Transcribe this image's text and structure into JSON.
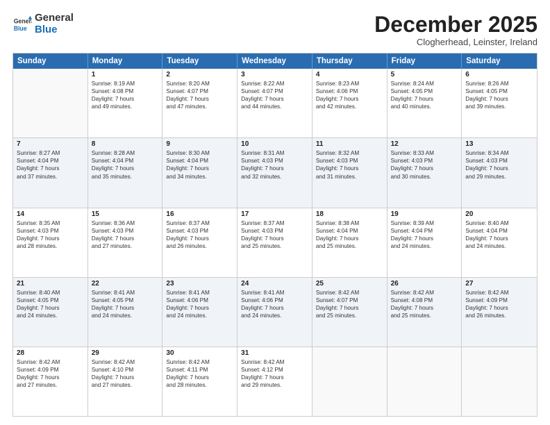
{
  "logo": {
    "general": "General",
    "blue": "Blue"
  },
  "header": {
    "month": "December 2025",
    "location": "Clogherhead, Leinster, Ireland"
  },
  "weekdays": [
    "Sunday",
    "Monday",
    "Tuesday",
    "Wednesday",
    "Thursday",
    "Friday",
    "Saturday"
  ],
  "weeks": [
    [
      {
        "day": "",
        "lines": []
      },
      {
        "day": "1",
        "lines": [
          "Sunrise: 8:19 AM",
          "Sunset: 4:08 PM",
          "Daylight: 7 hours",
          "and 49 minutes."
        ]
      },
      {
        "day": "2",
        "lines": [
          "Sunrise: 8:20 AM",
          "Sunset: 4:07 PM",
          "Daylight: 7 hours",
          "and 47 minutes."
        ]
      },
      {
        "day": "3",
        "lines": [
          "Sunrise: 8:22 AM",
          "Sunset: 4:07 PM",
          "Daylight: 7 hours",
          "and 44 minutes."
        ]
      },
      {
        "day": "4",
        "lines": [
          "Sunrise: 8:23 AM",
          "Sunset: 4:06 PM",
          "Daylight: 7 hours",
          "and 42 minutes."
        ]
      },
      {
        "day": "5",
        "lines": [
          "Sunrise: 8:24 AM",
          "Sunset: 4:05 PM",
          "Daylight: 7 hours",
          "and 40 minutes."
        ]
      },
      {
        "day": "6",
        "lines": [
          "Sunrise: 8:26 AM",
          "Sunset: 4:05 PM",
          "Daylight: 7 hours",
          "and 39 minutes."
        ]
      }
    ],
    [
      {
        "day": "7",
        "lines": [
          "Sunrise: 8:27 AM",
          "Sunset: 4:04 PM",
          "Daylight: 7 hours",
          "and 37 minutes."
        ]
      },
      {
        "day": "8",
        "lines": [
          "Sunrise: 8:28 AM",
          "Sunset: 4:04 PM",
          "Daylight: 7 hours",
          "and 35 minutes."
        ]
      },
      {
        "day": "9",
        "lines": [
          "Sunrise: 8:30 AM",
          "Sunset: 4:04 PM",
          "Daylight: 7 hours",
          "and 34 minutes."
        ]
      },
      {
        "day": "10",
        "lines": [
          "Sunrise: 8:31 AM",
          "Sunset: 4:03 PM",
          "Daylight: 7 hours",
          "and 32 minutes."
        ]
      },
      {
        "day": "11",
        "lines": [
          "Sunrise: 8:32 AM",
          "Sunset: 4:03 PM",
          "Daylight: 7 hours",
          "and 31 minutes."
        ]
      },
      {
        "day": "12",
        "lines": [
          "Sunrise: 8:33 AM",
          "Sunset: 4:03 PM",
          "Daylight: 7 hours",
          "and 30 minutes."
        ]
      },
      {
        "day": "13",
        "lines": [
          "Sunrise: 8:34 AM",
          "Sunset: 4:03 PM",
          "Daylight: 7 hours",
          "and 29 minutes."
        ]
      }
    ],
    [
      {
        "day": "14",
        "lines": [
          "Sunrise: 8:35 AM",
          "Sunset: 4:03 PM",
          "Daylight: 7 hours",
          "and 28 minutes."
        ]
      },
      {
        "day": "15",
        "lines": [
          "Sunrise: 8:36 AM",
          "Sunset: 4:03 PM",
          "Daylight: 7 hours",
          "and 27 minutes."
        ]
      },
      {
        "day": "16",
        "lines": [
          "Sunrise: 8:37 AM",
          "Sunset: 4:03 PM",
          "Daylight: 7 hours",
          "and 26 minutes."
        ]
      },
      {
        "day": "17",
        "lines": [
          "Sunrise: 8:37 AM",
          "Sunset: 4:03 PM",
          "Daylight: 7 hours",
          "and 25 minutes."
        ]
      },
      {
        "day": "18",
        "lines": [
          "Sunrise: 8:38 AM",
          "Sunset: 4:04 PM",
          "Daylight: 7 hours",
          "and 25 minutes."
        ]
      },
      {
        "day": "19",
        "lines": [
          "Sunrise: 8:39 AM",
          "Sunset: 4:04 PM",
          "Daylight: 7 hours",
          "and 24 minutes."
        ]
      },
      {
        "day": "20",
        "lines": [
          "Sunrise: 8:40 AM",
          "Sunset: 4:04 PM",
          "Daylight: 7 hours",
          "and 24 minutes."
        ]
      }
    ],
    [
      {
        "day": "21",
        "lines": [
          "Sunrise: 8:40 AM",
          "Sunset: 4:05 PM",
          "Daylight: 7 hours",
          "and 24 minutes."
        ]
      },
      {
        "day": "22",
        "lines": [
          "Sunrise: 8:41 AM",
          "Sunset: 4:05 PM",
          "Daylight: 7 hours",
          "and 24 minutes."
        ]
      },
      {
        "day": "23",
        "lines": [
          "Sunrise: 8:41 AM",
          "Sunset: 4:06 PM",
          "Daylight: 7 hours",
          "and 24 minutes."
        ]
      },
      {
        "day": "24",
        "lines": [
          "Sunrise: 8:41 AM",
          "Sunset: 4:06 PM",
          "Daylight: 7 hours",
          "and 24 minutes."
        ]
      },
      {
        "day": "25",
        "lines": [
          "Sunrise: 8:42 AM",
          "Sunset: 4:07 PM",
          "Daylight: 7 hours",
          "and 25 minutes."
        ]
      },
      {
        "day": "26",
        "lines": [
          "Sunrise: 8:42 AM",
          "Sunset: 4:08 PM",
          "Daylight: 7 hours",
          "and 25 minutes."
        ]
      },
      {
        "day": "27",
        "lines": [
          "Sunrise: 8:42 AM",
          "Sunset: 4:09 PM",
          "Daylight: 7 hours",
          "and 26 minutes."
        ]
      }
    ],
    [
      {
        "day": "28",
        "lines": [
          "Sunrise: 8:42 AM",
          "Sunset: 4:09 PM",
          "Daylight: 7 hours",
          "and 27 minutes."
        ]
      },
      {
        "day": "29",
        "lines": [
          "Sunrise: 8:42 AM",
          "Sunset: 4:10 PM",
          "Daylight: 7 hours",
          "and 27 minutes."
        ]
      },
      {
        "day": "30",
        "lines": [
          "Sunrise: 8:42 AM",
          "Sunset: 4:11 PM",
          "Daylight: 7 hours",
          "and 28 minutes."
        ]
      },
      {
        "day": "31",
        "lines": [
          "Sunrise: 8:42 AM",
          "Sunset: 4:12 PM",
          "Daylight: 7 hours",
          "and 29 minutes."
        ]
      },
      {
        "day": "",
        "lines": []
      },
      {
        "day": "",
        "lines": []
      },
      {
        "day": "",
        "lines": []
      }
    ]
  ]
}
